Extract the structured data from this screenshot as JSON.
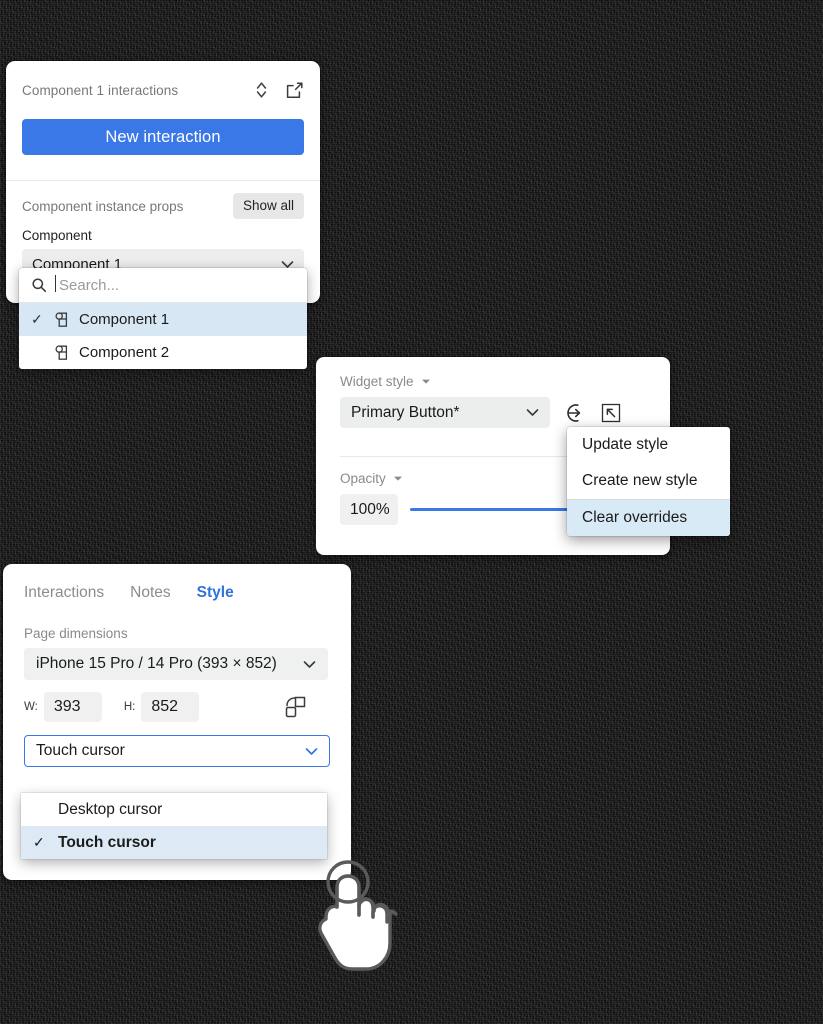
{
  "interactions_panel": {
    "caption": "Component 1 interactions",
    "icons": {
      "sort": "chevron-updown-icon",
      "expand": "external-link-icon"
    },
    "new_interaction_label": "New interaction",
    "props_label": "Component instance props",
    "show_all_label": "Show all",
    "component_field_label": "Component",
    "component_selected": "Component 1",
    "dropdown": {
      "search_placeholder": "Search...",
      "options": [
        {
          "label": "Component 1",
          "selected": true,
          "check": "✓"
        },
        {
          "label": "Component 2",
          "selected": false,
          "check": ""
        }
      ]
    }
  },
  "widget_panel": {
    "style_label": "Widget style",
    "style_selected": "Primary Button*",
    "opacity_label": "Opacity",
    "opacity_value": "100%",
    "opacity_percent": 100,
    "icons": {
      "apply": "arrow-into-circle-icon",
      "detach": "boxed-arrow-up-left-icon"
    }
  },
  "style_menu": {
    "items": [
      {
        "label": "Update style",
        "highlighted": false
      },
      {
        "label": "Create new style",
        "highlighted": false
      },
      {
        "label": "Clear overrides",
        "highlighted": true
      }
    ]
  },
  "style_panel": {
    "tabs": [
      {
        "label": "Interactions",
        "active": false
      },
      {
        "label": "Notes",
        "active": false
      },
      {
        "label": "Style",
        "active": true
      }
    ],
    "page_dimensions_label": "Page dimensions",
    "device_selected": "iPhone 15 Pro / 14 Pro  (393 × 852)",
    "width_label": "W:",
    "width_value": "393",
    "height_label": "H:",
    "height_value": "852",
    "link_icon": "link-dimensions-icon",
    "cursor_selected": "Touch cursor",
    "cursor_options": [
      {
        "label": "Desktop cursor",
        "selected": false,
        "check": ""
      },
      {
        "label": "Touch cursor",
        "selected": true,
        "check": "✓"
      }
    ]
  },
  "colors": {
    "accent_blue": "#3b78e7",
    "tab_active_blue": "#2f72e0",
    "highlight_blue": "#d7e8f4",
    "menu_highlight_blue": "#d9eaf7",
    "field_grey": "#eceded",
    "background": "#141414"
  }
}
